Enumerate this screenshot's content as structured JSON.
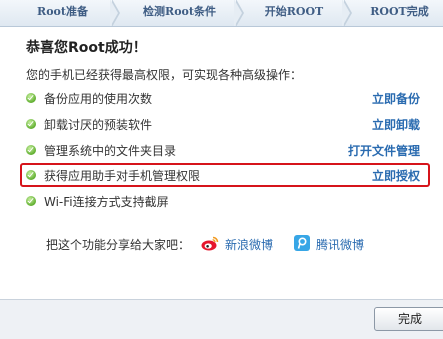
{
  "steps": {
    "items": [
      "Root准备",
      "检测Root条件",
      "开始ROOT",
      "ROOT完成"
    ]
  },
  "main": {
    "title": "恭喜您Root成功！",
    "subtitle": "您的手机已经获得最高权限，可实现各种高级操作：",
    "features": [
      {
        "label": "备份应用的使用次数",
        "action": "立即备份"
      },
      {
        "label": "卸载讨厌的预装软件",
        "action": "立即卸载"
      },
      {
        "label": "管理系统中的文件夹目录",
        "action": "打开文件管理"
      },
      {
        "label": "获得应用助手对手机管理权限",
        "action": "立即授权"
      },
      {
        "label": "Wi-Fi连接方式支持截屏",
        "action": ""
      }
    ]
  },
  "share": {
    "label": "把这个功能分享给大家吧：",
    "weibo": "新浪微博",
    "tencent": "腾讯微博"
  },
  "footer": {
    "done": "完成"
  },
  "colors": {
    "accent_link": "#2a6bb0",
    "highlight_border": "#d6141b",
    "check_green": "#5fae2e"
  }
}
